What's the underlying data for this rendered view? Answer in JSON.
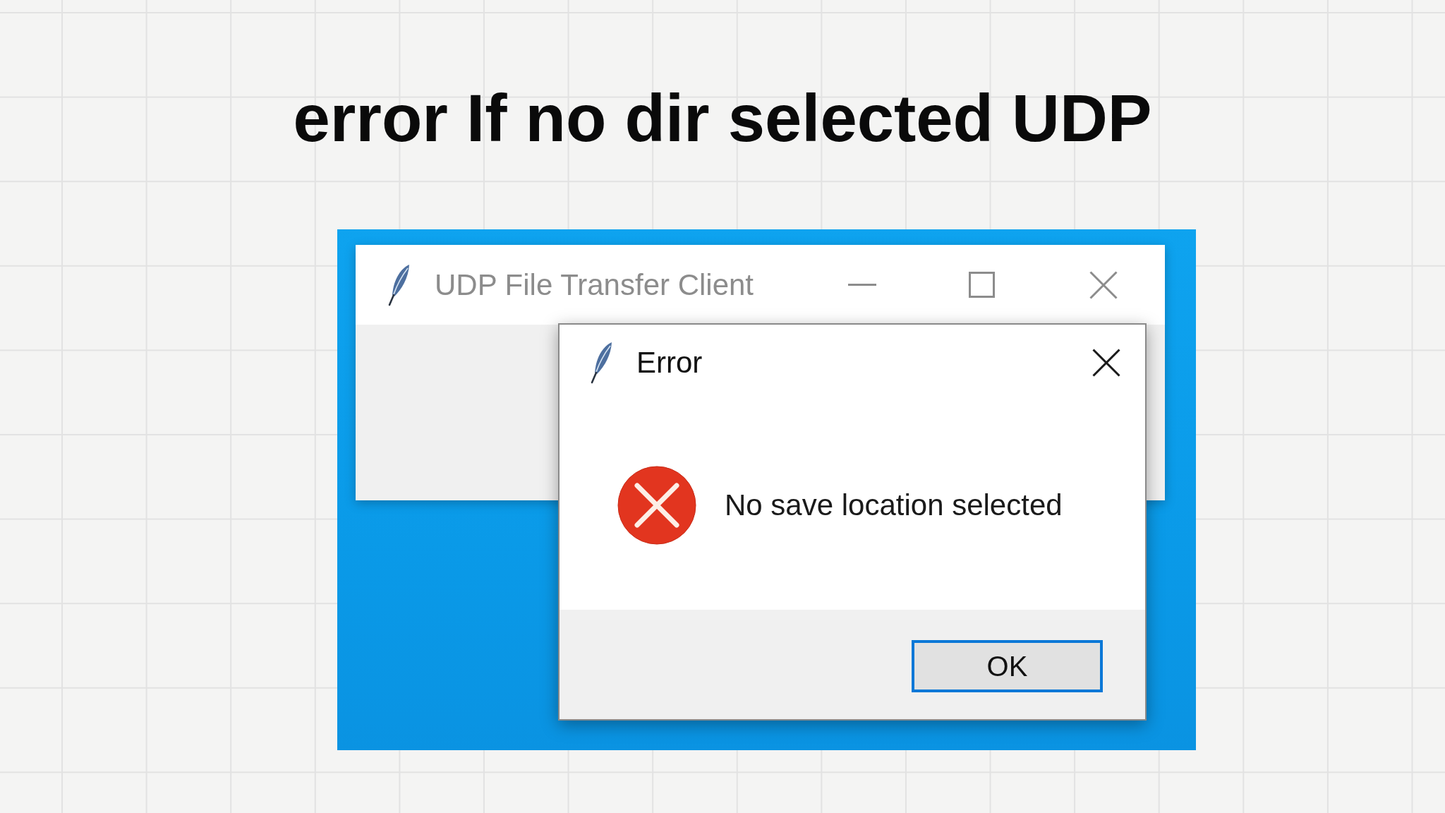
{
  "heading": "error If no dir selected UDP",
  "main_window": {
    "title": "UDP File Transfer Client",
    "active": false
  },
  "dialog": {
    "kind": "error",
    "title": "Error",
    "message": "No save location selected",
    "buttons": [
      {
        "label": "OK",
        "focused": true
      }
    ]
  }
}
